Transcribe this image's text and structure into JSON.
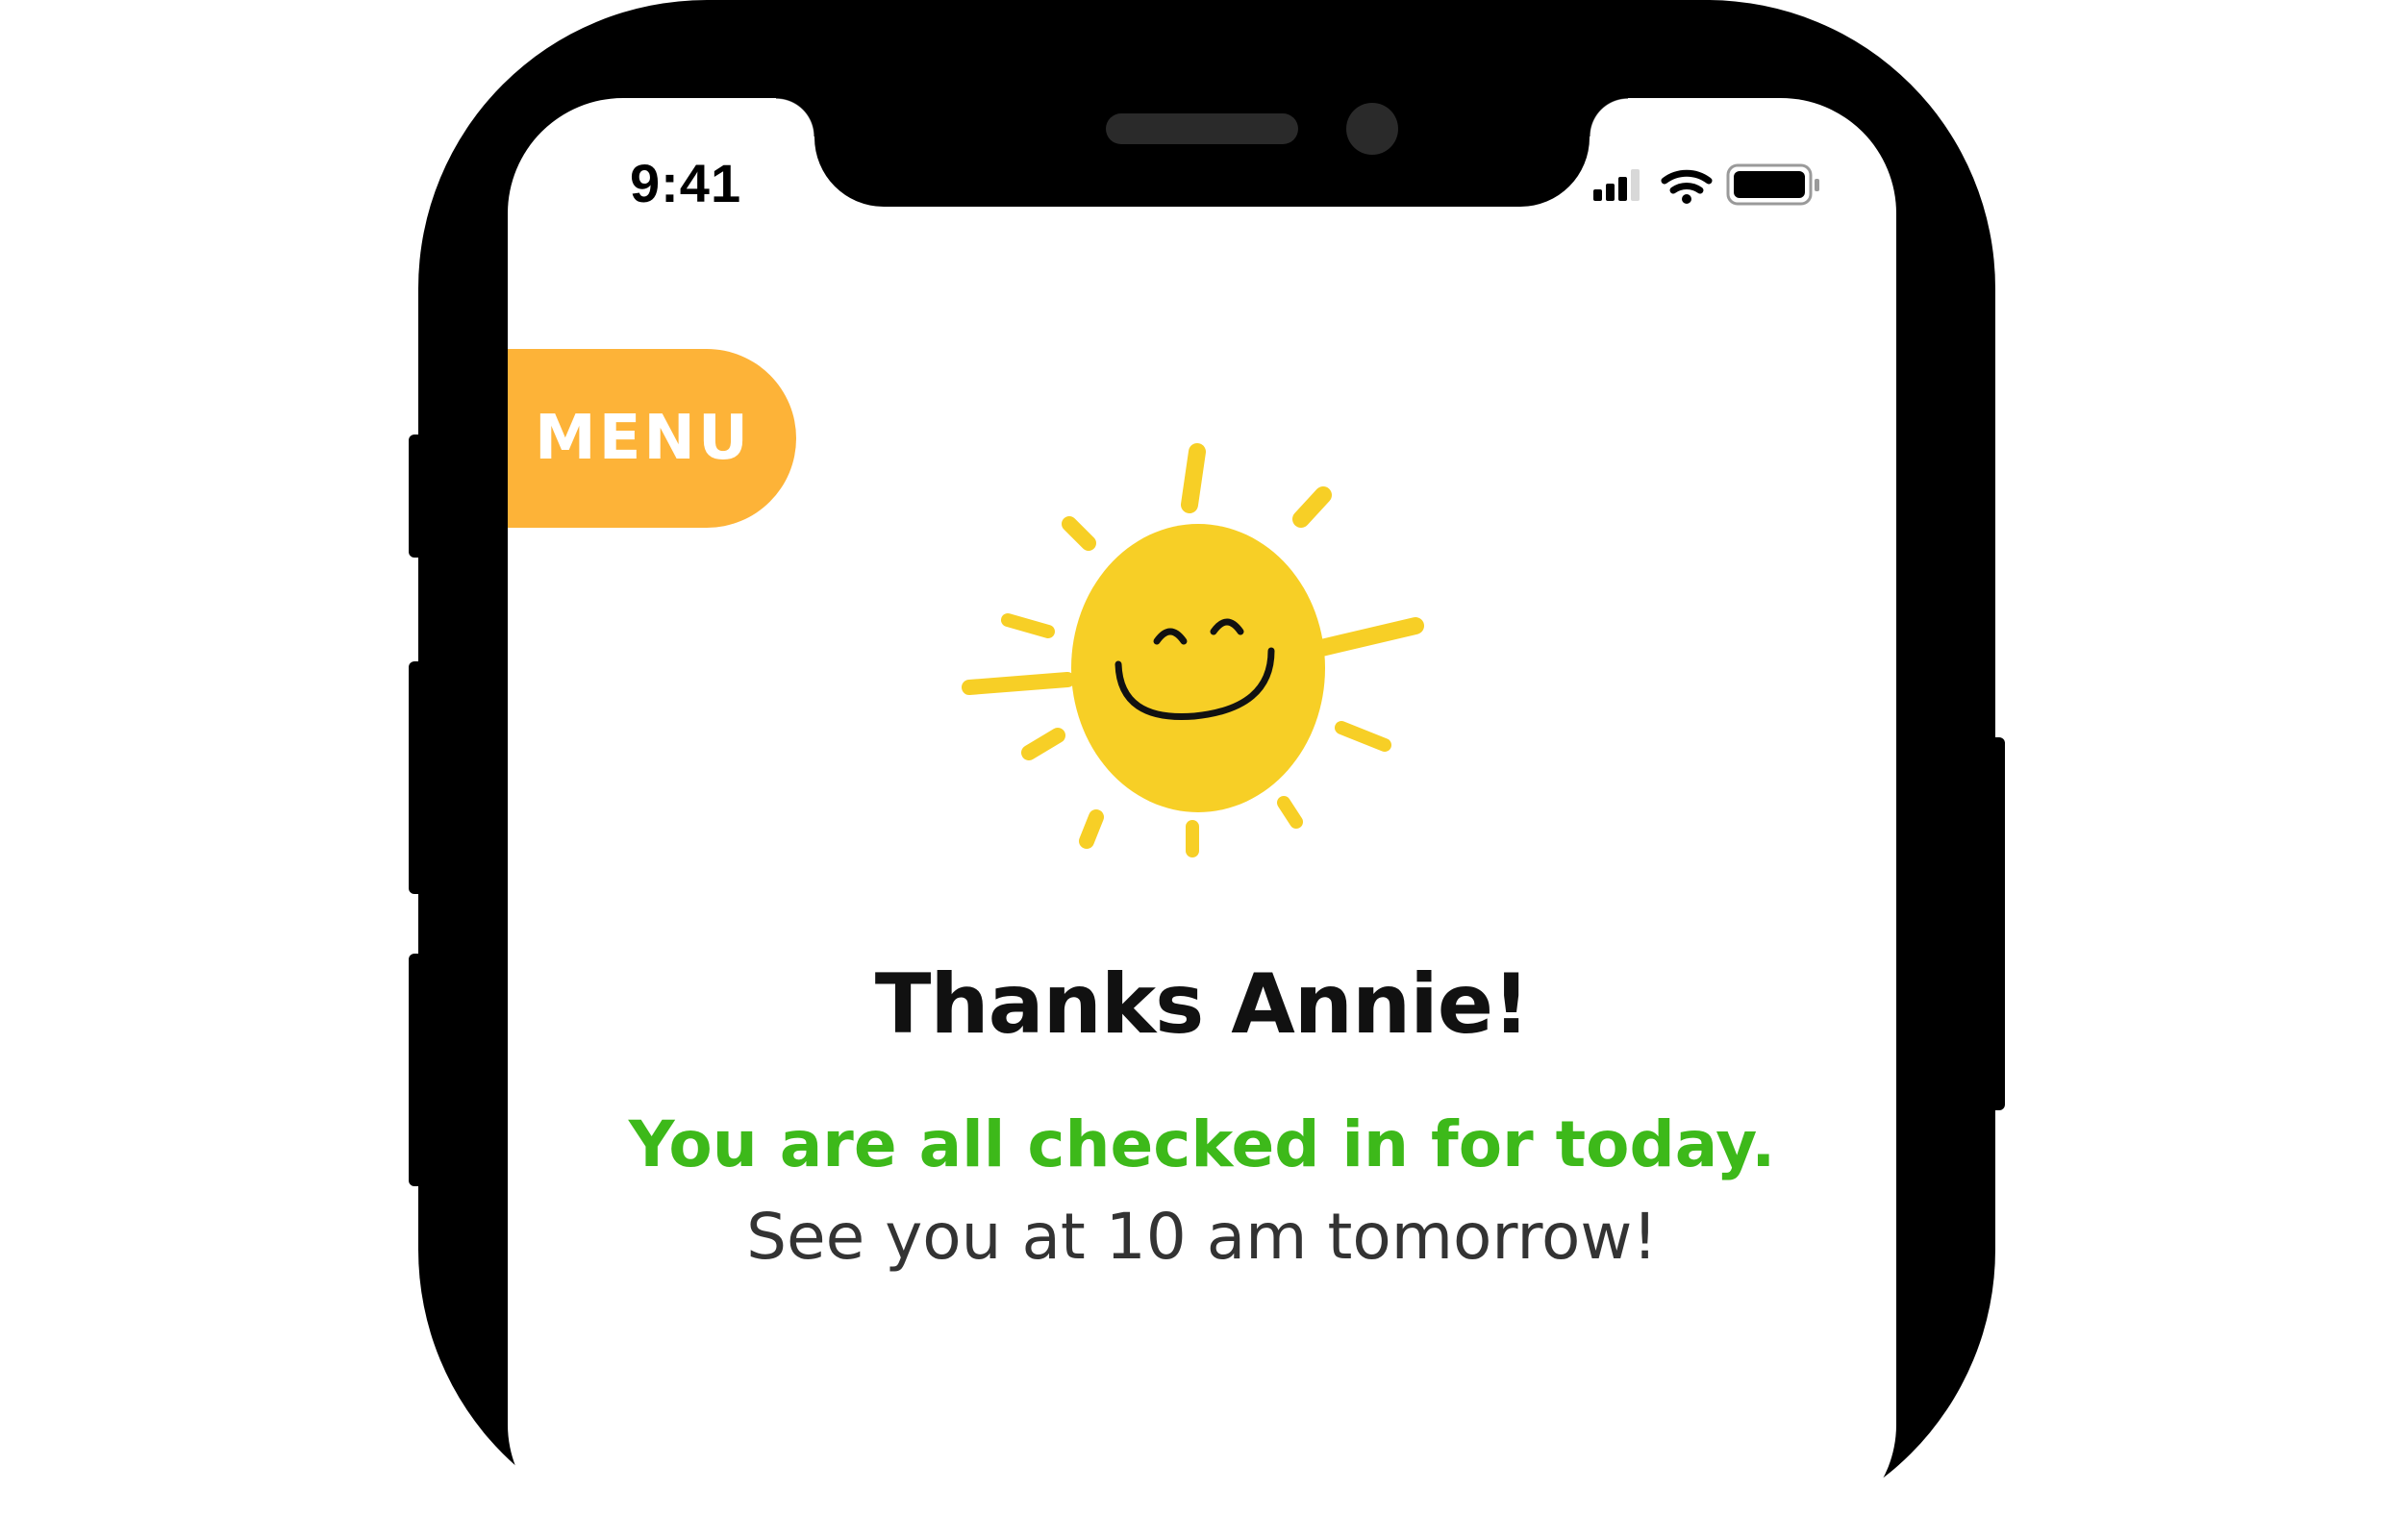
{
  "status_bar": {
    "time": "9:41",
    "icons": [
      "signal-icon",
      "wifi-icon",
      "battery-icon"
    ]
  },
  "menu": {
    "label": "MENU"
  },
  "illustration": {
    "icon": "smiling-sun-icon"
  },
  "content": {
    "title": "Thanks Annie!",
    "confirmation": "You are all checked in for today.",
    "next_visit": "See you at 10 am tomorrow!"
  },
  "colors": {
    "menu_bg": "#FDB338",
    "sun": "#F7CF26",
    "confirmation_text": "#3DB91A",
    "secondary_text": "#333333"
  }
}
